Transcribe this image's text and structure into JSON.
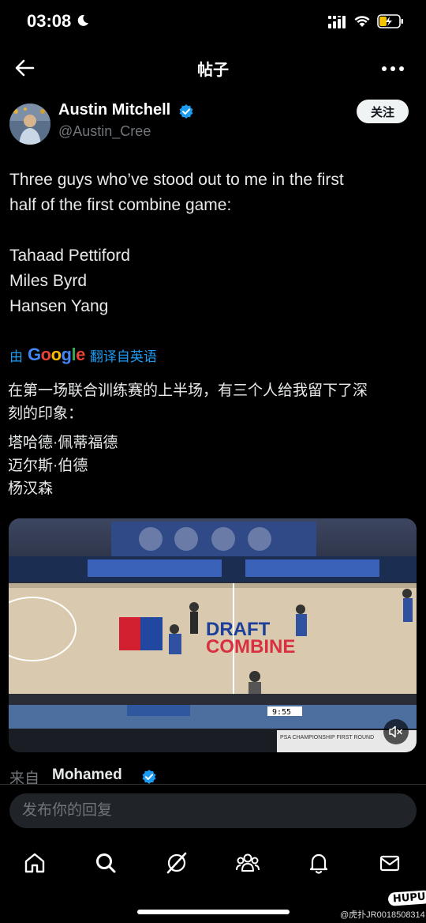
{
  "status_bar": {
    "time": "03:08"
  },
  "header": {
    "title": "帖子"
  },
  "author": {
    "name": "Austin Mitchell",
    "handle": "@Austin_Cree",
    "follow_label": "关注"
  },
  "tweet": {
    "lines": [
      "Three guys who’ve stood out to me in the first",
      "half of the first combine game:",
      "",
      "Tahaad Pettiford",
      "Miles Byrd",
      "Hansen Yang"
    ]
  },
  "translate": {
    "prefix": "由",
    "brand": "Google",
    "action": "翻译自英语"
  },
  "translation": {
    "lines": [
      "在第一场联合训练赛的上半场，有三个人给我留下了深",
      "刻的印象：",
      "塔哈德·佩蒂福德",
      "迈尔斯·伯德",
      "杨汉森"
    ]
  },
  "video": {
    "score_text": "9:55",
    "overlay_text": "PSA CHAMPIONSHIP FIRST ROUND"
  },
  "source": {
    "label": "来自",
    "name": "Mohamed"
  },
  "reply": {
    "placeholder": "发布你的回复"
  },
  "nav": [
    "home-icon",
    "search-icon",
    "grok-icon",
    "communities-icon",
    "notifications-icon",
    "messages-icon"
  ],
  "watermark": {
    "logo": "HUPU",
    "text": "@虎扑JR0018508314"
  },
  "colors": {
    "accent": "#1d9bf0",
    "background": "#000000",
    "muted": "#71767b"
  }
}
